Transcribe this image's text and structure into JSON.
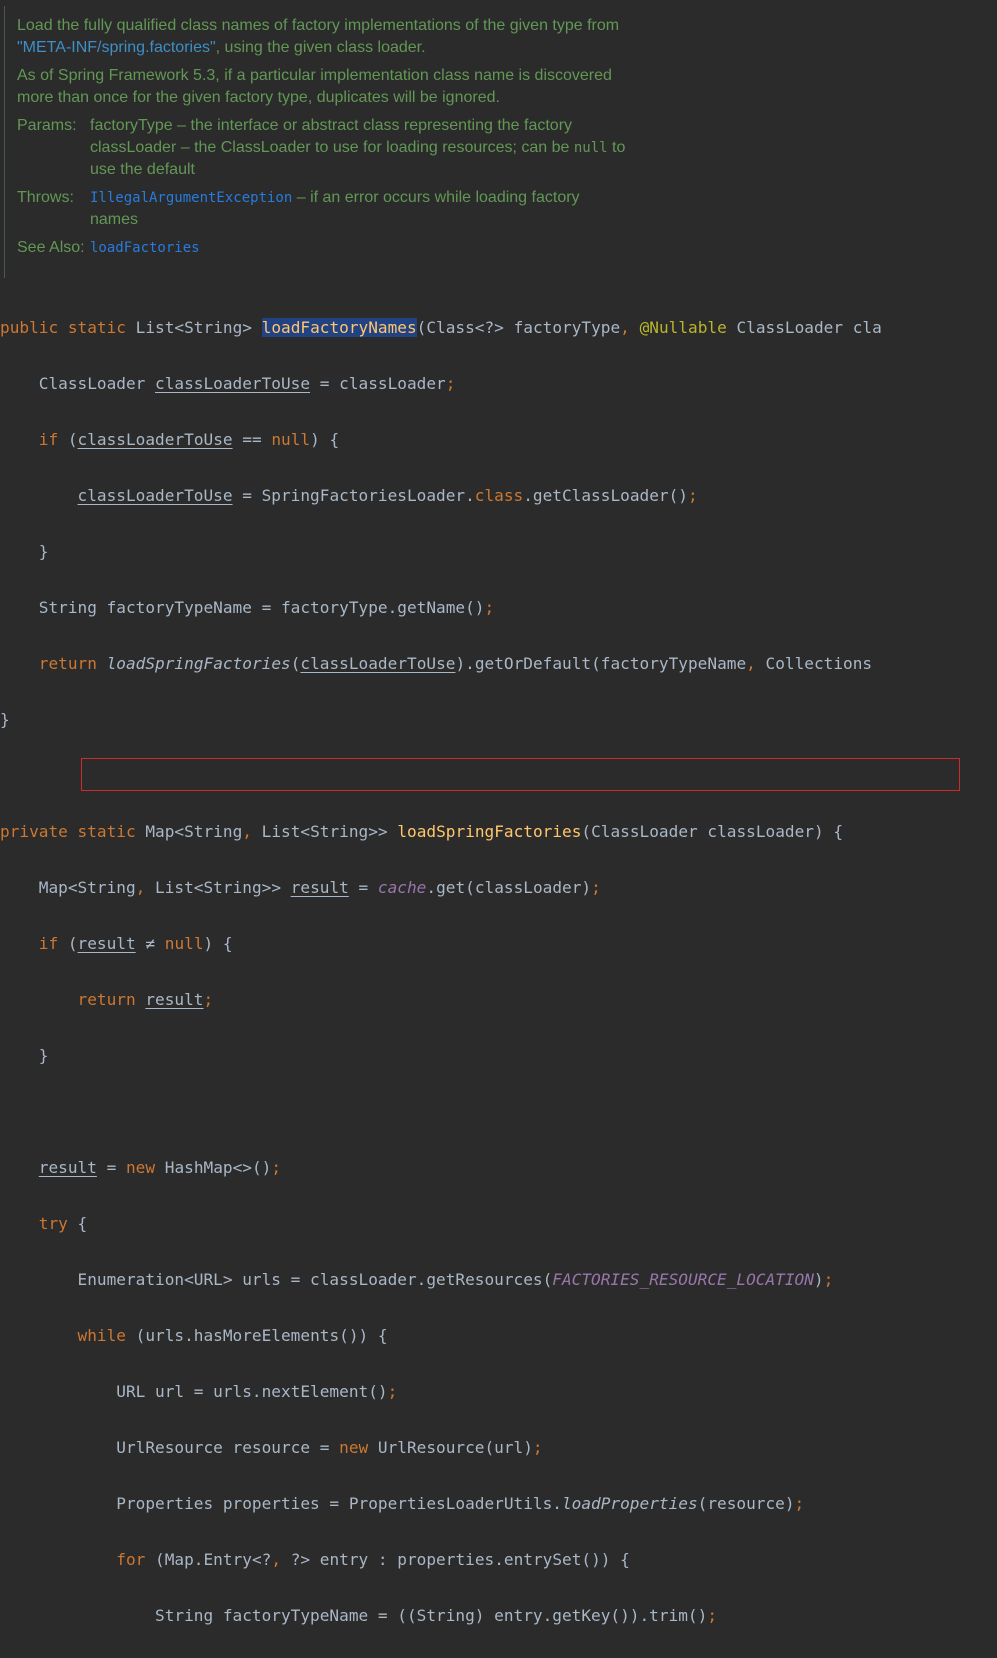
{
  "doc": {
    "p1_a": "Load the fully qualified class names of factory implementations of the given type from ",
    "p1_link": "\"META-INF/spring.factories\"",
    "p1_b": ", using the given class loader.",
    "p2": "As of Spring Framework 5.3, if a particular implementation class name is discovered more than once for the given factory type, duplicates will be ignored.",
    "params_label": "Params:",
    "param1": "factoryType – the interface or abstract class representing the factory",
    "param2_a": "classLoader – the ClassLoader to use for loading resources; can be ",
    "param2_null": "null",
    "param2_b": " to use the default",
    "throws_label": "Throws:",
    "throws_exc": "IllegalArgumentException",
    "throws_desc": " – if an error occurs while loading factory names",
    "see_label": "See Also:",
    "see_link": "loadFactories"
  },
  "code": {
    "public": "public",
    "private": "private",
    "static": "static",
    "if": "if",
    "null": "null",
    "return": "return",
    "new": "new",
    "try": "try",
    "while": "while",
    "for": "for",
    "class_kw": "class",
    "nullable": "@Nullable",
    "fn_load_factory_names": "loadFactoryNames",
    "fn_load_spring_factories": "loadSpringFactories",
    "var_cltu": "classLoaderToUse",
    "var_result": "result",
    "cache": "cache",
    "const_frl": "FACTORIES_RESOURCE_LOCATION",
    "fn_load_properties": "loadProperties",
    "l1_a": " List<String> ",
    "l1_b": "(Class<?> factoryType",
    "l1_c": " ClassLoader cla",
    "l2_a": "    ClassLoader ",
    "l2_b": " = classLoader",
    "l3_b": " == ",
    "l3_c": ") {",
    "l4_b": " = SpringFactoriesLoader.",
    "l4_c": ".getClassLoader()",
    "l5": "    }",
    "l6_a": "    String factoryTypeName = factoryType.getName()",
    "l7_b": "(",
    "l7_c": ").getOrDefault(factoryTypeName",
    "l7_d": " Collections",
    "l8": "}",
    "l10_a": " Map<String",
    "l10_b": " List<String>> ",
    "l10_c": "(ClassLoader classLoader) {",
    "l11_a": "    Map<String",
    "l11_b": " List<String>> ",
    "l11_c": " = ",
    "l11_d": ".get(classLoader)",
    "l12_b": " ≠ ",
    "l15_b": " HashMap<>()",
    "l16_b": " {",
    "l17_a": "        Enumeration<URL> urls = classLoader.getResources(",
    "l17_b": ")",
    "l18_b": " (urls.hasMoreElements()) {",
    "l19_a": "            URL url = urls.nextElement()",
    "l20_a": "            UrlResource resource = ",
    "l20_b": " UrlResource(url)",
    "l21_a": "            Properties properties = PropertiesLoaderUtils.",
    "l21_b": "(resource)",
    "l22_b": " (Map.Entry<?",
    "l22_c": " ?> entry : properties.entrySet()) {",
    "l23": "                String factoryTypeName = ((String) entry.getKey()).trim()",
    "semi": ";",
    "comma": ","
  }
}
